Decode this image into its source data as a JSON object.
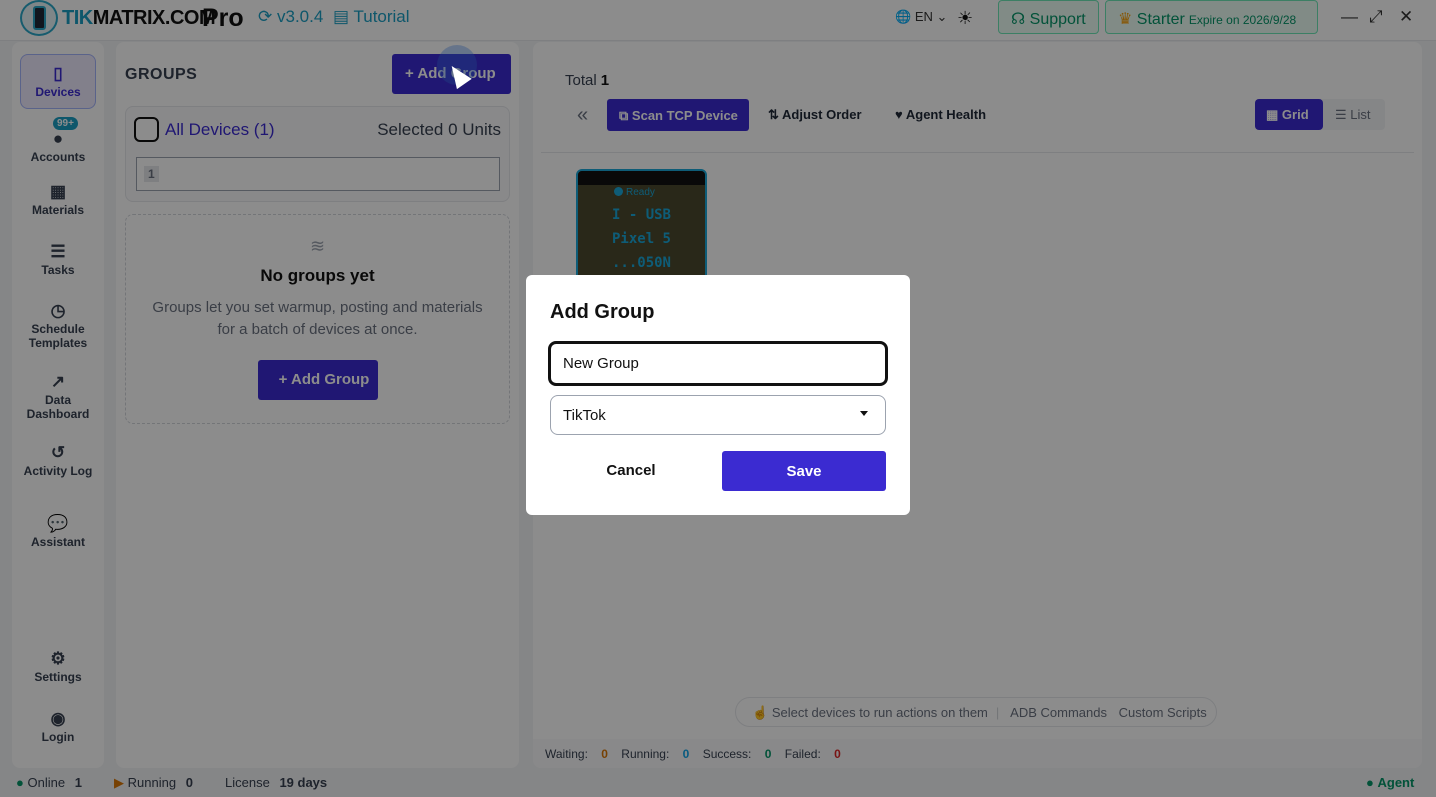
{
  "app": {
    "brand_prefix": "TIK",
    "brand_suffix": "MATRIX.COM",
    "edition": "Pro",
    "version": "v3.0.4",
    "tutorial": "Tutorial",
    "language": "EN",
    "support": "Support",
    "plan": "Starter",
    "expire": "Expire on 2026/9/28"
  },
  "sidebar": {
    "items": [
      {
        "label": "Devices",
        "icon": "phone-icon"
      },
      {
        "label": "Accounts",
        "icon": "user-icon",
        "badge": "99+"
      },
      {
        "label": "Materials",
        "icon": "film-icon"
      },
      {
        "label": "Tasks",
        "icon": "checklist-icon"
      },
      {
        "label": "Schedule Templates",
        "icon": "clock-icon"
      },
      {
        "label": "Data Dashboard",
        "icon": "chart-line-icon"
      },
      {
        "label": "Activity Log",
        "icon": "history-icon"
      },
      {
        "label": "Assistant",
        "icon": "chat-icon"
      },
      {
        "label": "Settings",
        "icon": "gear-icon"
      },
      {
        "label": "Login",
        "icon": "user-circle-icon"
      }
    ]
  },
  "groups": {
    "title": "GROUPS",
    "add_button": "+ Add Group",
    "all_devices": "All Devices (1)",
    "selected": "Selected 0 Units",
    "device_chip": "1",
    "empty_title": "No groups yet",
    "empty_desc": "Groups let you set warmup, posting and materials for a batch of devices at once.",
    "empty_add": "+ Add Group"
  },
  "main": {
    "total_label": "Total",
    "total_value": "1",
    "scan_tcp": "Scan TCP Device",
    "adjust_order": "Adjust Order",
    "agent_health": "Agent Health",
    "view_grid": "Grid",
    "view_list": "List",
    "device": {
      "status": "Ready",
      "line1": "I - USB",
      "line2": "Pixel 5",
      "line3": "...050N"
    },
    "hint": "Select devices to run actions on them",
    "adb": "ADB Commands",
    "scripts": "Custom Scripts",
    "waiting_label": "Waiting:",
    "waiting": "0",
    "running_label": "Running:",
    "running": "0",
    "success_label": "Success:",
    "success": "0",
    "failed_label": "Failed:",
    "failed": "0"
  },
  "statusbar": {
    "online_label": "Online",
    "online": "1",
    "running_label": "Running",
    "running": "0",
    "license_label": "License",
    "license": "19 days",
    "agent": "Agent"
  },
  "modal": {
    "title": "Add Group",
    "name_value": "New Group",
    "platform": "TikTok",
    "cancel": "Cancel",
    "save": "Save"
  },
  "colors": {
    "primary": "#3b2bd1",
    "accent": "#1a9ec4",
    "success": "#059669"
  }
}
